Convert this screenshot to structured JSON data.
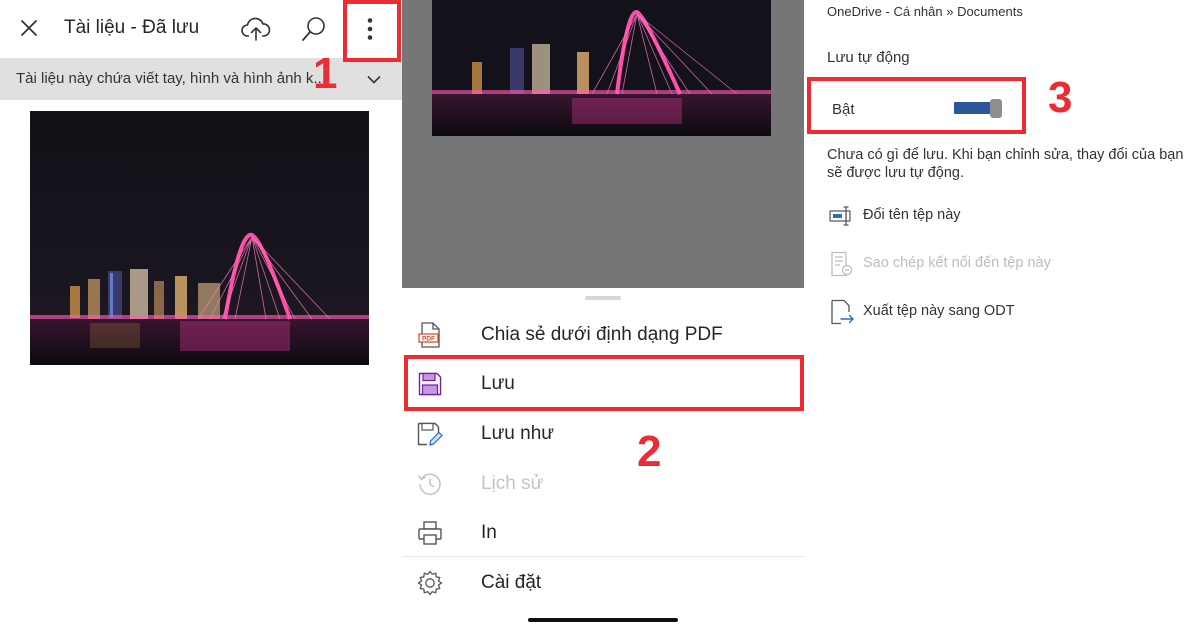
{
  "panel1": {
    "title": "Tài liệu - Đã lưu",
    "info_banner": "Tài liệu này chứa viết tay, hình và hình ảnh k...",
    "icons": [
      "close-icon",
      "cloud-upload-icon",
      "search-icon",
      "more-vertical-icon",
      "chevron-down-icon"
    ],
    "step_label": "1"
  },
  "panel2": {
    "menu": [
      {
        "label": "Chia sẻ dưới định dạng PDF",
        "icon": "pdf-icon",
        "enabled": true
      },
      {
        "label": "Lưu",
        "icon": "save-icon",
        "enabled": true
      },
      {
        "label": "Lưu như",
        "icon": "save-as-icon",
        "enabled": true
      },
      {
        "label": "Lịch sử",
        "icon": "history-icon",
        "enabled": false
      },
      {
        "label": "In",
        "icon": "print-icon",
        "enabled": true
      },
      {
        "label": "Cài đặt",
        "icon": "settings-icon",
        "enabled": true
      }
    ],
    "step_label": "2"
  },
  "panel3": {
    "path": "OneDrive - Cá nhân » Documents",
    "autosave_heading": "Lưu tự động",
    "toggle_label": "Bật",
    "toggle_on": true,
    "description": "Chưa có gì để lưu. Khi bạn chỉnh sửa, thay đổi của bạn sẽ được lưu tự động.",
    "actions": [
      {
        "label": "Đổi tên tệp này",
        "icon": "rename-icon",
        "enabled": true
      },
      {
        "label": "Sao chép kết nối đến tệp này",
        "icon": "copy-link-icon",
        "enabled": false
      },
      {
        "label": "Xuất tệp này sang ODT",
        "icon": "export-icon",
        "enabled": true
      }
    ],
    "step_label": "3"
  },
  "colors": {
    "highlight": "#ee2a33",
    "toggle_on": "#2b579a",
    "sheet_backdrop": "#767676",
    "info_banner_bg": "#e0e0e0"
  }
}
